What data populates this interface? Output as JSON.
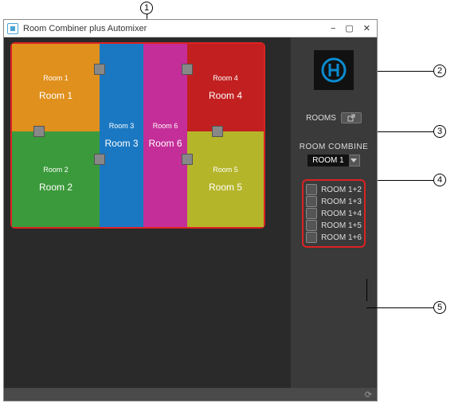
{
  "window": {
    "title": "Room Combiner plus Automixer"
  },
  "rooms": {
    "r1": {
      "small": "Room 1",
      "big": "Room 1"
    },
    "r2": {
      "small": "Room 2",
      "big": "Room 2"
    },
    "r3": {
      "small": "Room 3",
      "big": "Room 3"
    },
    "r4": {
      "small": "Room 4",
      "big": "Room 4"
    },
    "r5": {
      "small": "Room 5",
      "big": "Room 5"
    },
    "r6": {
      "small": "Room 6",
      "big": "Room 6"
    }
  },
  "side": {
    "rooms_label": "ROOMS",
    "combine_title": "ROOM COMBINE",
    "dropdown_value": "ROOM 1",
    "combine_list": [
      "ROOM 1+2",
      "ROOM 1+3",
      "ROOM 1+4",
      "ROOM 1+5",
      "ROOM 1+6"
    ]
  },
  "callouts": {
    "c1": "1",
    "c2": "2",
    "c3": "3",
    "c4": "4",
    "c5": "5"
  }
}
